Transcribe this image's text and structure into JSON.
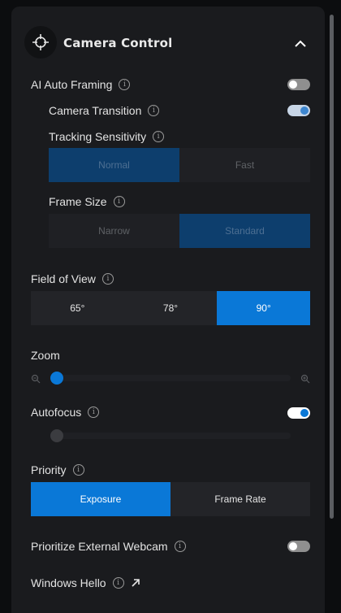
{
  "header": {
    "title": "Camera Control"
  },
  "ai_auto_framing": {
    "label": "AI Auto Framing",
    "enabled": false
  },
  "camera_transition": {
    "label": "Camera Transition",
    "enabled": true
  },
  "tracking_sensitivity": {
    "label": "Tracking Sensitivity",
    "options": [
      "Normal",
      "Fast"
    ],
    "selected": "Normal"
  },
  "frame_size": {
    "label": "Frame Size",
    "options": [
      "Narrow",
      "Standard"
    ],
    "selected": "Standard"
  },
  "field_of_view": {
    "label": "Field of View",
    "options": [
      "65°",
      "78°",
      "90°"
    ],
    "selected": "90°"
  },
  "zoom": {
    "label": "Zoom",
    "level": 0
  },
  "autofocus": {
    "label": "Autofocus",
    "enabled": true,
    "manual_focus_level": 0
  },
  "priority": {
    "label": "Priority",
    "options": [
      "Exposure",
      "Frame Rate"
    ],
    "selected": "Exposure"
  },
  "prioritize_external_webcam": {
    "label": "Prioritize External Webcam",
    "enabled": false
  },
  "windows_hello": {
    "label": "Windows Hello"
  },
  "colors": {
    "accent": "#0a78d7",
    "accent_dim": "#0d3e6d",
    "panel": "#1a1b1e"
  },
  "icons": [
    "camera-crosshair-icon",
    "chevron-up-icon",
    "info-icon",
    "external-link-icon",
    "zoom-out-icon",
    "zoom-in-icon"
  ]
}
